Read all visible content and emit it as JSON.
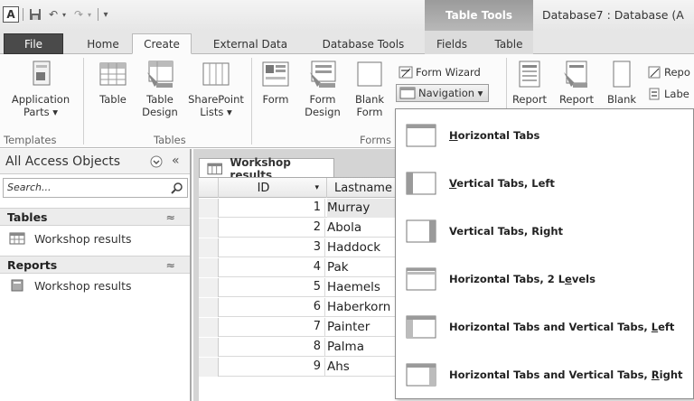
{
  "titlebar": {
    "app_letter": "A",
    "context_tab_group": "Table Tools",
    "window_title": "Database7 : Database (A"
  },
  "tabs": {
    "file": "File",
    "home": "Home",
    "create": "Create",
    "external_data": "External Data",
    "database_tools": "Database Tools",
    "fields": "Fields",
    "table": "Table"
  },
  "ribbon": {
    "app_parts": [
      "Application",
      "Parts ▾"
    ],
    "table": "Table",
    "table_design": [
      "Table",
      "Design"
    ],
    "sharepoint": [
      "SharePoint",
      "Lists ▾"
    ],
    "form": "Form",
    "form_design": [
      "Form",
      "Design"
    ],
    "blank_form": [
      "Blank",
      "Form"
    ],
    "form_wizard": "Form Wizard",
    "navigation": "Navigation ▾",
    "report_partial": "Repo",
    "labels_partial": "Labe",
    "report_under_1": "Report",
    "report_under_2": "Report",
    "report_under_3": "Blank",
    "groups": {
      "templates": "Templates",
      "tables": "Tables",
      "forms": "Forms"
    }
  },
  "navpane": {
    "title": "All Access Objects",
    "search_placeholder": "Search...",
    "sections": [
      {
        "label": "Tables",
        "items": [
          "Workshop results"
        ]
      },
      {
        "label": "Reports",
        "items": [
          "Workshop results"
        ]
      }
    ]
  },
  "document": {
    "tab_label": "Workshop results",
    "columns": [
      "ID",
      "Lastname"
    ],
    "rows": [
      {
        "id": "1",
        "lastname": "Murray"
      },
      {
        "id": "2",
        "lastname": "Abola"
      },
      {
        "id": "3",
        "lastname": "Haddock"
      },
      {
        "id": "4",
        "lastname": "Pak"
      },
      {
        "id": "5",
        "lastname": "Haemels"
      },
      {
        "id": "6",
        "lastname": "Haberkorn"
      },
      {
        "id": "7",
        "lastname": "Painter"
      },
      {
        "id": "8",
        "lastname": "Palma"
      },
      {
        "id": "9",
        "lastname": "Ahs"
      }
    ]
  },
  "navigation_menu": [
    {
      "pre": "",
      "key": "H",
      "post": "orizontal Tabs",
      "icon": "horizontal-tabs-icon"
    },
    {
      "pre": "",
      "key": "V",
      "post": "ertical Tabs, Left",
      "icon": "vertical-tabs-left-icon"
    },
    {
      "pre": "Vertical Tabs, Ri",
      "key": "g",
      "post": "ht",
      "icon": "vertical-tabs-right-icon"
    },
    {
      "pre": "Horizontal Tabs, 2 L",
      "key": "e",
      "post": "vels",
      "icon": "horizontal-tabs-2-levels-icon"
    },
    {
      "pre": "Horizontal Tabs and Vertical Tabs, ",
      "key": "L",
      "post": "eft",
      "icon": "horizontal-vertical-tabs-left-icon"
    },
    {
      "pre": "Horizontal Tabs and Vertical Tabs, ",
      "key": "R",
      "post": "ight",
      "icon": "horizontal-vertical-tabs-right-icon"
    }
  ]
}
